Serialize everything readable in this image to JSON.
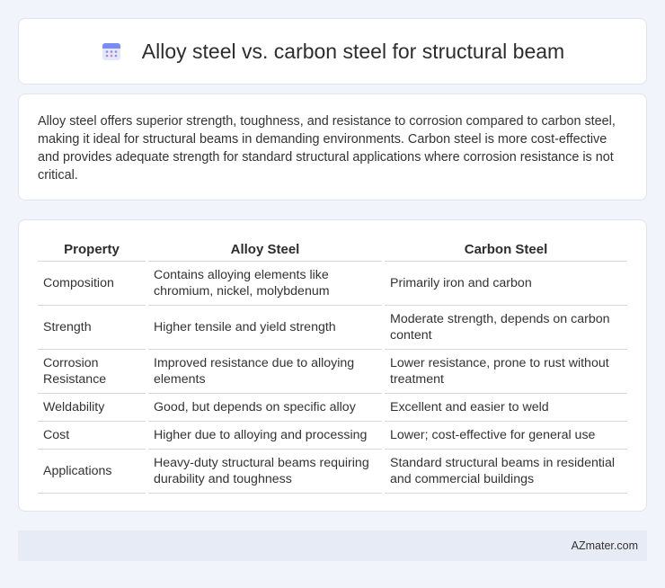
{
  "header": {
    "title": "Alloy steel vs. carbon steel for structural beam",
    "icon": "calendar-icon"
  },
  "intro": {
    "text": "Alloy steel offers superior strength, toughness, and resistance to corrosion compared to carbon steel, making it ideal for structural beams in demanding environments. Carbon steel is more cost-effective and provides adequate strength for standard structural applications where corrosion resistance is not critical."
  },
  "table": {
    "headers": [
      "Property",
      "Alloy Steel",
      "Carbon Steel"
    ],
    "rows": [
      [
        "Composition",
        "Contains alloying elements like chromium, nickel, molybdenum",
        "Primarily iron and carbon"
      ],
      [
        "Strength",
        "Higher tensile and yield strength",
        "Moderate strength, depends on carbon content"
      ],
      [
        "Corrosion Resistance",
        "Improved resistance due to alloying elements",
        "Lower resistance, prone to rust without treatment"
      ],
      [
        "Weldability",
        "Good, but depends on specific alloy",
        "Excellent and easier to weld"
      ],
      [
        "Cost",
        "Higher due to alloying and processing",
        "Lower; cost-effective for general use"
      ],
      [
        "Applications",
        "Heavy-duty structural beams requiring durability and toughness",
        "Standard structural beams in residential and commercial buildings"
      ]
    ]
  },
  "footer": {
    "brand": "AZmater.com"
  }
}
